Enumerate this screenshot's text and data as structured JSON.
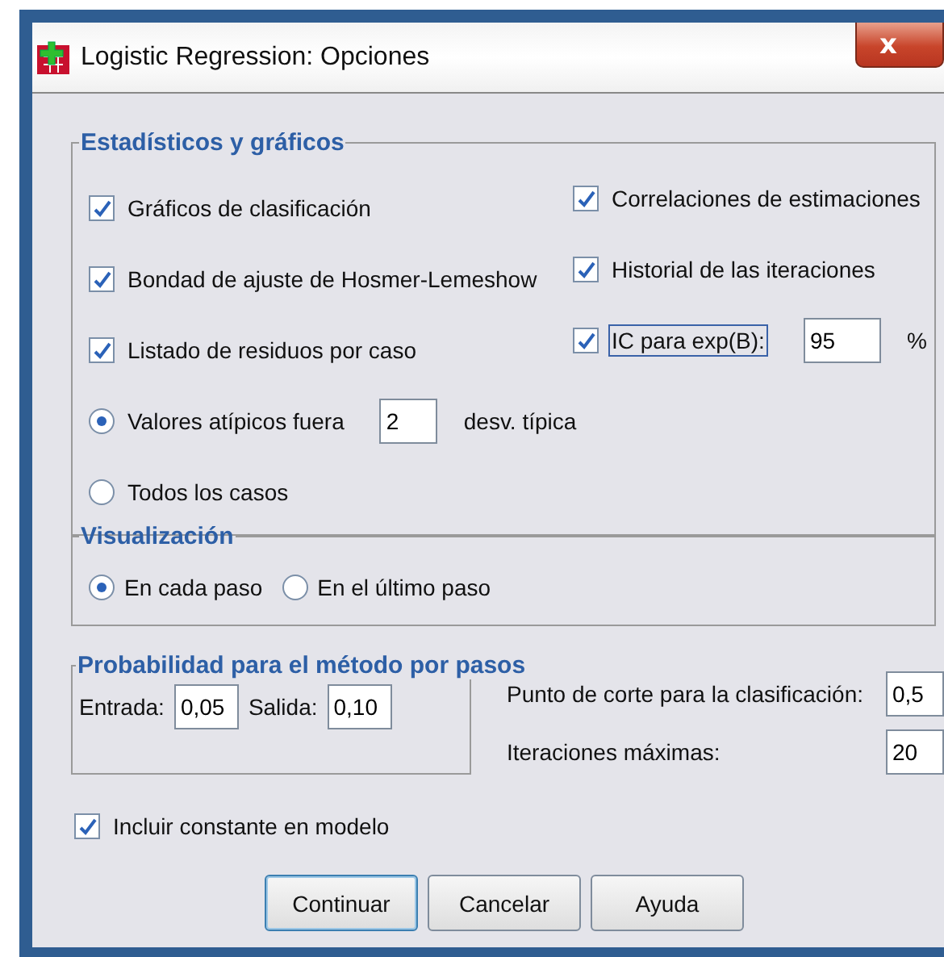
{
  "window": {
    "title": "Logistic Regression: Opciones",
    "close": "x"
  },
  "statistics": {
    "title": "Estadísticos y gráficos",
    "left": [
      {
        "kind": "check",
        "label": "Gráficos de clasificación",
        "checked": true
      },
      {
        "kind": "check",
        "label": "Bondad de ajuste de Hosmer-Lemeshow",
        "checked": true
      },
      {
        "kind": "check",
        "label": "Listado de residuos por caso",
        "checked": true
      },
      {
        "kind": "radio",
        "label": "Valores atípicos fuera",
        "selected": true,
        "value": "2",
        "suffix": "desv. típica"
      },
      {
        "kind": "radio",
        "label": "Todos los casos",
        "selected": false
      }
    ],
    "right": [
      {
        "kind": "check",
        "label": "Correlaciones de estimaciones",
        "checked": true
      },
      {
        "kind": "check",
        "label": "Historial de las iteraciones",
        "checked": true
      },
      {
        "kind": "check",
        "label": "IC para exp(B):",
        "checked": true,
        "focused": true,
        "value": "95",
        "suffix": "%"
      }
    ]
  },
  "display": {
    "title": "Visualización",
    "options": [
      {
        "label": "En cada paso",
        "selected": true
      },
      {
        "label": "En el último paso",
        "selected": false
      }
    ]
  },
  "stepwise": {
    "title": "Probabilidad para el método por pasos",
    "fields": [
      {
        "label": "Entrada:",
        "value": "0,05"
      },
      {
        "label": "Salida:",
        "value": "0,10"
      }
    ]
  },
  "settings": [
    {
      "label": "Punto de corte para la clasificación:",
      "value": "0,5"
    },
    {
      "label": "Iteraciones máximas:",
      "value": "20"
    }
  ],
  "include_constant": {
    "label": "Incluir constante en modelo",
    "checked": true
  },
  "buttons": [
    {
      "label": "Continuar",
      "default": true
    },
    {
      "label": "Cancelar",
      "default": false
    },
    {
      "label": "Ayuda",
      "default": false
    }
  ]
}
